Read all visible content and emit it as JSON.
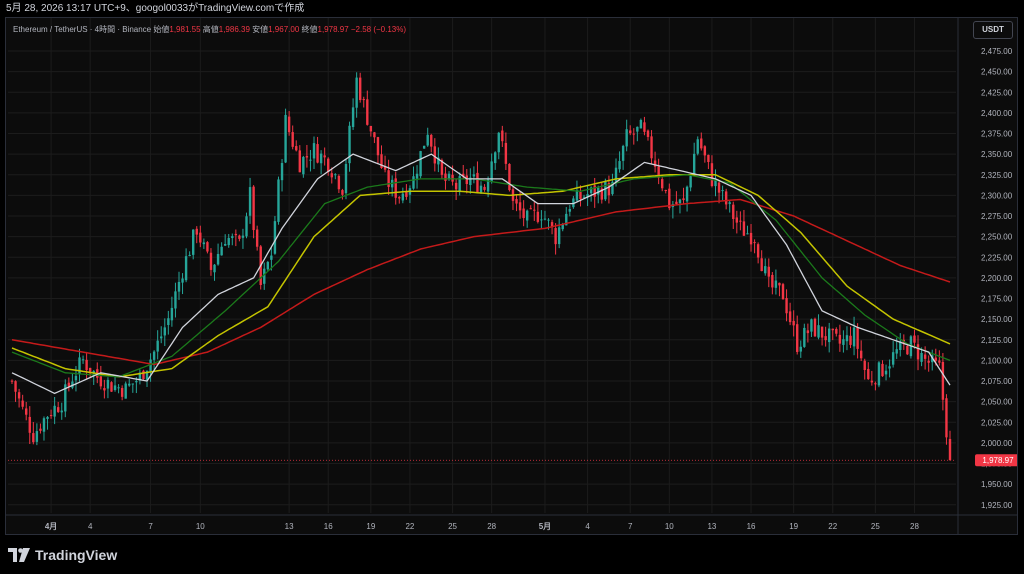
{
  "topbar": {
    "text": "5月 28, 2026 13:17 UTC+9、googol0033がTradingView.comで作成"
  },
  "legend": {
    "symbol": "Ethereum / TetherUS · 4時間 · Binance",
    "open_label": "始値",
    "open": "1,981.55",
    "high_label": "高値",
    "high": "1,986.39",
    "low_label": "安値",
    "low": "1,967.00",
    "close_label": "終値",
    "close": "1,978.97",
    "change": "−2.58 (−0.13%)"
  },
  "toolbar": {
    "currency_button": "USDT"
  },
  "brand": {
    "name": "TradingView"
  },
  "colors": {
    "up": "#26a69a",
    "down": "#f23645",
    "ma_fast": "#d1d4dc",
    "ma_mid": "#1b7a1b",
    "ma_slow": "#c4c400",
    "ma_long": "#c41a1a",
    "grid": "#1c1c1c"
  },
  "chart_data": {
    "type": "candlestick",
    "title": "Ethereum / TetherUS · 4時間 · Binance",
    "timeframe": "4h",
    "ylim": [
      1915,
      2515
    ],
    "y_ticks": [
      "1,925.00",
      "1,950.00",
      "1,975.00",
      "2,000.00",
      "2,025.00",
      "2,050.00",
      "2,075.00",
      "2,100.00",
      "2,125.00",
      "2,150.00",
      "2,175.00",
      "2,200.00",
      "2,225.00",
      "2,250.00",
      "2,275.00",
      "2,300.00",
      "2,325.00",
      "2,350.00",
      "2,375.00",
      "2,400.00",
      "2,425.00",
      "2,450.00",
      "2,475.00"
    ],
    "x_ticks": [
      "4月",
      "4",
      "7",
      "10",
      "13",
      "16",
      "19",
      "22",
      "25",
      "28",
      "5月",
      "4",
      "7",
      "10",
      "13",
      "16",
      "19",
      "22",
      "25",
      "28"
    ],
    "last_price_label": "1,978.97",
    "last_price": 1978.97,
    "close_anchors": [
      [
        0,
        2075
      ],
      [
        3,
        2040
      ],
      [
        6,
        2010
      ],
      [
        10,
        2035
      ],
      [
        14,
        2050
      ],
      [
        17,
        2080
      ],
      [
        20,
        2100
      ],
      [
        24,
        2080
      ],
      [
        28,
        2070
      ],
      [
        32,
        2065
      ],
      [
        36,
        2080
      ],
      [
        40,
        2110
      ],
      [
        44,
        2150
      ],
      [
        48,
        2210
      ],
      [
        52,
        2260
      ],
      [
        56,
        2210
      ],
      [
        60,
        2250
      ],
      [
        64,
        2240
      ],
      [
        67,
        2300
      ],
      [
        70,
        2190
      ],
      [
        73,
        2230
      ],
      [
        77,
        2390
      ],
      [
        81,
        2340
      ],
      [
        85,
        2355
      ],
      [
        89,
        2340
      ],
      [
        93,
        2310
      ],
      [
        97,
        2440
      ],
      [
        101,
        2380
      ],
      [
        105,
        2320
      ],
      [
        109,
        2300
      ],
      [
        113,
        2320
      ],
      [
        117,
        2380
      ],
      [
        121,
        2320
      ],
      [
        125,
        2310
      ],
      [
        129,
        2320
      ],
      [
        133,
        2310
      ],
      [
        137,
        2380
      ],
      [
        141,
        2290
      ],
      [
        145,
        2270
      ],
      [
        149,
        2280
      ],
      [
        153,
        2250
      ],
      [
        157,
        2290
      ],
      [
        161,
        2300
      ],
      [
        165,
        2305
      ],
      [
        169,
        2310
      ],
      [
        173,
        2370
      ],
      [
        177,
        2380
      ],
      [
        181,
        2340
      ],
      [
        185,
        2290
      ],
      [
        189,
        2290
      ],
      [
        193,
        2370
      ],
      [
        197,
        2320
      ],
      [
        201,
        2290
      ],
      [
        205,
        2260
      ],
      [
        209,
        2250
      ],
      [
        213,
        2190
      ],
      [
        217,
        2180
      ],
      [
        221,
        2120
      ],
      [
        225,
        2140
      ],
      [
        229,
        2130
      ],
      [
        233,
        2120
      ],
      [
        237,
        2130
      ],
      [
        241,
        2075
      ],
      [
        245,
        2090
      ],
      [
        249,
        2110
      ],
      [
        253,
        2120
      ],
      [
        257,
        2100
      ],
      [
        261,
        2090
      ],
      [
        264,
        1980
      ]
    ],
    "ma_fast_anchors": [
      [
        0,
        2085
      ],
      [
        12,
        2060
      ],
      [
        25,
        2085
      ],
      [
        38,
        2075
      ],
      [
        48,
        2140
      ],
      [
        58,
        2180
      ],
      [
        68,
        2200
      ],
      [
        76,
        2260
      ],
      [
        86,
        2320
      ],
      [
        96,
        2350
      ],
      [
        108,
        2330
      ],
      [
        118,
        2350
      ],
      [
        128,
        2320
      ],
      [
        138,
        2320
      ],
      [
        148,
        2290
      ],
      [
        158,
        2290
      ],
      [
        168,
        2310
      ],
      [
        178,
        2340
      ],
      [
        188,
        2330
      ],
      [
        198,
        2320
      ],
      [
        208,
        2300
      ],
      [
        218,
        2240
      ],
      [
        228,
        2160
      ],
      [
        238,
        2140
      ],
      [
        248,
        2125
      ],
      [
        258,
        2110
      ],
      [
        264,
        2070
      ]
    ],
    "ma_mid_anchors": [
      [
        0,
        2110
      ],
      [
        15,
        2085
      ],
      [
        30,
        2080
      ],
      [
        45,
        2105
      ],
      [
        60,
        2160
      ],
      [
        75,
        2220
      ],
      [
        88,
        2290
      ],
      [
        100,
        2310
      ],
      [
        115,
        2320
      ],
      [
        130,
        2320
      ],
      [
        145,
        2310
      ],
      [
        160,
        2305
      ],
      [
        175,
        2320
      ],
      [
        190,
        2325
      ],
      [
        202,
        2315
      ],
      [
        215,
        2270
      ],
      [
        228,
        2200
      ],
      [
        240,
        2155
      ],
      [
        252,
        2120
      ],
      [
        264,
        2100
      ]
    ],
    "ma_slow_anchors": [
      [
        0,
        2115
      ],
      [
        15,
        2090
      ],
      [
        30,
        2080
      ],
      [
        45,
        2090
      ],
      [
        58,
        2130
      ],
      [
        72,
        2165
      ],
      [
        85,
        2250
      ],
      [
        98,
        2300
      ],
      [
        112,
        2305
      ],
      [
        126,
        2305
      ],
      [
        140,
        2300
      ],
      [
        155,
        2305
      ],
      [
        170,
        2320
      ],
      [
        185,
        2325
      ],
      [
        198,
        2325
      ],
      [
        210,
        2300
      ],
      [
        222,
        2255
      ],
      [
        235,
        2190
      ],
      [
        248,
        2150
      ],
      [
        264,
        2120
      ]
    ],
    "ma_long_anchors": [
      [
        0,
        2125
      ],
      [
        20,
        2110
      ],
      [
        40,
        2095
      ],
      [
        55,
        2110
      ],
      [
        70,
        2140
      ],
      [
        85,
        2180
      ],
      [
        100,
        2210
      ],
      [
        115,
        2235
      ],
      [
        130,
        2250
      ],
      [
        150,
        2260
      ],
      [
        170,
        2280
      ],
      [
        190,
        2290
      ],
      [
        205,
        2295
      ],
      [
        220,
        2275
      ],
      [
        235,
        2245
      ],
      [
        250,
        2215
      ],
      [
        264,
        2195
      ]
    ]
  }
}
